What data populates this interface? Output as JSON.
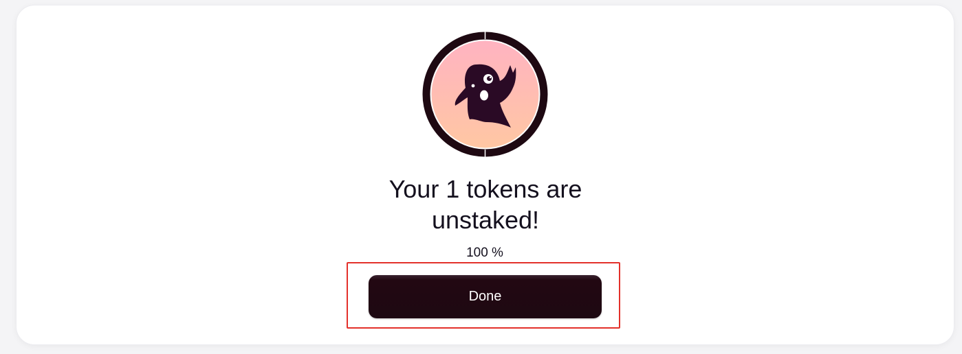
{
  "status": {
    "title_line1": "Your 1 tokens are",
    "title_line2": "unstaked!",
    "progress_percent": 100,
    "progress_label": "100 %"
  },
  "actions": {
    "done_label": "Done"
  },
  "avatar": {
    "icon": "ghost-mascot-icon",
    "background_top": "#ffb3c1",
    "background_bottom": "#ffc9a0",
    "ring_color": "#1e0912"
  },
  "colors": {
    "button_bg": "#1e0912",
    "highlight_border": "#e3302a",
    "text": "#14101e"
  }
}
